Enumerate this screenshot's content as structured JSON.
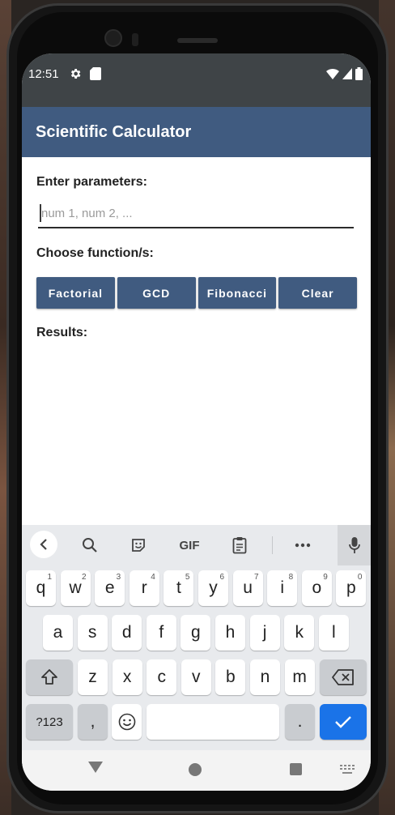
{
  "status_bar": {
    "time": "12:51",
    "left_icons": [
      "gear-icon",
      "sd-card-icon"
    ],
    "right_icons": [
      "wifi-icon",
      "cell-signal-icon",
      "battery-icon"
    ]
  },
  "app_bar": {
    "title": "Scientific Calculator"
  },
  "form": {
    "params_label": "Enter parameters:",
    "params_placeholder": "num 1, num 2, ...",
    "params_value": "",
    "function_label": "Choose function/s:",
    "buttons": [
      "Factorial",
      "GCD",
      "Fibonacci",
      "Clear"
    ],
    "results_label": "Results:"
  },
  "keyboard": {
    "toolbar": [
      "back-arrow-icon",
      "search-icon",
      "sticker-icon",
      "GIF",
      "clipboard-icon",
      "more-icon",
      "mic-icon"
    ],
    "row1": [
      {
        "k": "q",
        "s": "1"
      },
      {
        "k": "w",
        "s": "2"
      },
      {
        "k": "e",
        "s": "3"
      },
      {
        "k": "r",
        "s": "4"
      },
      {
        "k": "t",
        "s": "5"
      },
      {
        "k": "y",
        "s": "6"
      },
      {
        "k": "u",
        "s": "7"
      },
      {
        "k": "i",
        "s": "8"
      },
      {
        "k": "o",
        "s": "9"
      },
      {
        "k": "p",
        "s": "0"
      }
    ],
    "row2": [
      "a",
      "s",
      "d",
      "f",
      "g",
      "h",
      "j",
      "k",
      "l"
    ],
    "row3": [
      "z",
      "x",
      "c",
      "v",
      "b",
      "n",
      "m"
    ],
    "row4": {
      "symbols": "?123",
      "comma": ",",
      "period": "."
    },
    "colors": {
      "accent": "#1a73e8",
      "bg": "#e8eaed",
      "key": "#ffffff",
      "special_key": "#c9ccd0"
    }
  },
  "colors": {
    "app_bar": "#405b80",
    "status_bar": "#3f4447",
    "button": "#405b80"
  }
}
